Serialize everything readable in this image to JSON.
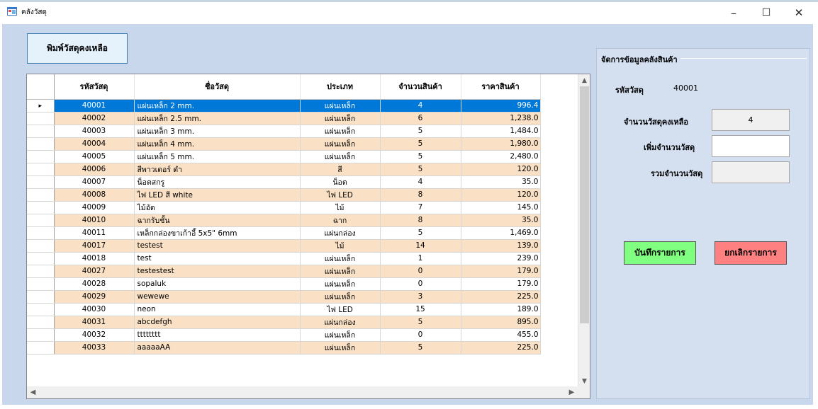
{
  "window": {
    "title": "คลังวัสดุ",
    "minimize": "–",
    "maximize": "☐",
    "close": "✕"
  },
  "toolbar": {
    "print_label": "พิมพ์วัสดุคงเหลือ"
  },
  "grid": {
    "columns": [
      "รหัสวัสดุ",
      "ชื่อวัสดุ",
      "ประเภท",
      "จำนวนสินค้า",
      "ราคาสินค้า"
    ],
    "selected_row_marker": "▸",
    "rows": [
      [
        "40001",
        "แผ่นเหล็ก 2 mm.",
        "แผ่นเหล็ก",
        "4",
        "996.4"
      ],
      [
        "40002",
        "แผ่นเหล็ก 2.5 mm.",
        "แผ่นเหล็ก",
        "6",
        "1,238.0"
      ],
      [
        "40003",
        "แผ่นเหล็ก 3 mm.",
        "แผ่นเหล็ก",
        "5",
        "1,484.0"
      ],
      [
        "40004",
        "แผ่นเหล็ก 4 mm.",
        "แผ่นเหล็ก",
        "5",
        "1,980.0"
      ],
      [
        "40005",
        "แผ่นเหล็ก 5 mm.",
        "แผ่นเหล็ก",
        "5",
        "2,480.0"
      ],
      [
        "40006",
        "สีพาวเดอร์ ดำ",
        "สี",
        "5",
        "120.0"
      ],
      [
        "40007",
        "น็อตสกรู",
        "น็อต",
        "4",
        "35.0"
      ],
      [
        "40008",
        "ไฟ LED สี white",
        "ไฟ LED",
        "8",
        "120.0"
      ],
      [
        "40009",
        "ไม้อัด",
        "ไม้",
        "7",
        "145.0"
      ],
      [
        "40010",
        "ฉากรับชั้น",
        "ฉาก",
        "8",
        "35.0"
      ],
      [
        "40011",
        "เหล็กกล่องขาเก้าอี้ 5x5\" 6mm",
        "แผ่นกล่อง",
        "5",
        "1,469.0"
      ],
      [
        "40017",
        "testest",
        "ไม้",
        "14",
        "139.0"
      ],
      [
        "40018",
        "test",
        "แผ่นเหล็ก",
        "1",
        "239.0"
      ],
      [
        "40027",
        "testestest",
        "แผ่นเหล็ก",
        "0",
        "179.0"
      ],
      [
        "40028",
        "sopaluk",
        "แผ่นเหล็ก",
        "0",
        "179.0"
      ],
      [
        "40029",
        "wewewe",
        "แผ่นเหล็ก",
        "3",
        "225.0"
      ],
      [
        "40030",
        "neon",
        "ไฟ LED",
        "15",
        "189.0"
      ],
      [
        "40031",
        "abcdefgh",
        "แผ่นกล่อง",
        "5",
        "895.0"
      ],
      [
        "40032",
        "tttttttt",
        "แผ่นเหล็ก",
        "0",
        "455.0"
      ],
      [
        "40033",
        "aaaaaAA",
        "แผ่นเหล็ก",
        "5",
        "225.0"
      ]
    ]
  },
  "panel": {
    "group_title": "จัดการข้อมูลคลังสินค้า",
    "code_label": "รหัสวัสดุ",
    "code_value": "40001",
    "remaining_label": "จำนวนวัสดุคงเหลือ",
    "remaining_value": "4",
    "add_label": "เพิ่มจำนวนวัสดุ",
    "add_value": "",
    "total_label": "รวมจำนวนวัสดุ",
    "total_value": "",
    "save_label": "บันทึกรายการ",
    "cancel_label": "ยกเลิกรายการ"
  },
  "colors": {
    "save_button": "#80ff80",
    "cancel_button": "#ff8080",
    "selection": "#0078d7",
    "alt_row": "#fae0c4"
  }
}
